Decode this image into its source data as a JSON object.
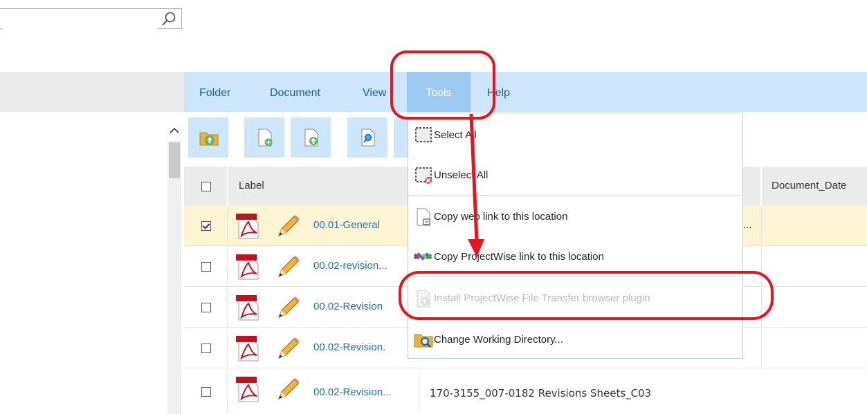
{
  "search": {
    "value": "",
    "placeholder": ""
  },
  "menubar": {
    "items": [
      "Folder",
      "Document",
      "View",
      "Tools",
      "Help"
    ],
    "active": "Tools"
  },
  "grid": {
    "columns": [
      "Label",
      "Document_Date"
    ],
    "header_checkbox": false,
    "rows": [
      {
        "checked": true,
        "label": "00.01-General",
        "description": "..."
      },
      {
        "checked": false,
        "label": "00.02-revision...",
        "description": ""
      },
      {
        "checked": false,
        "label": "00.02-Revision",
        "description": ""
      },
      {
        "checked": false,
        "label": "00.02-Revision.",
        "description": ""
      },
      {
        "checked": false,
        "label": "00.02-Revision...",
        "description": "170-3155_007-0182 Revisions Sheets_C03"
      }
    ]
  },
  "tools_menu": {
    "items": [
      {
        "label": "Select All",
        "icon": "select-all-icon",
        "enabled": true
      },
      {
        "label": "Unselect All",
        "icon": "unselect-all-icon",
        "enabled": true
      },
      {
        "label": "Copy web link to this location",
        "icon": "web-link-icon",
        "enabled": true
      },
      {
        "label": "Copy ProjectWise link to this location",
        "icon": "projectwise-link-icon",
        "enabled": true
      },
      {
        "label": "Install ProjectWise File Transfer browser plugin",
        "icon": "install-plugin-icon",
        "enabled": false
      },
      {
        "label": "Change Working Directory...",
        "icon": "folder-search-icon",
        "enabled": true
      }
    ]
  },
  "colors": {
    "menubar": "#cde6fb",
    "active_menu": "#9cc9f1",
    "link": "#1d6fb8",
    "selected_row": "#fdf5d4",
    "annotation": "#e8131b"
  }
}
